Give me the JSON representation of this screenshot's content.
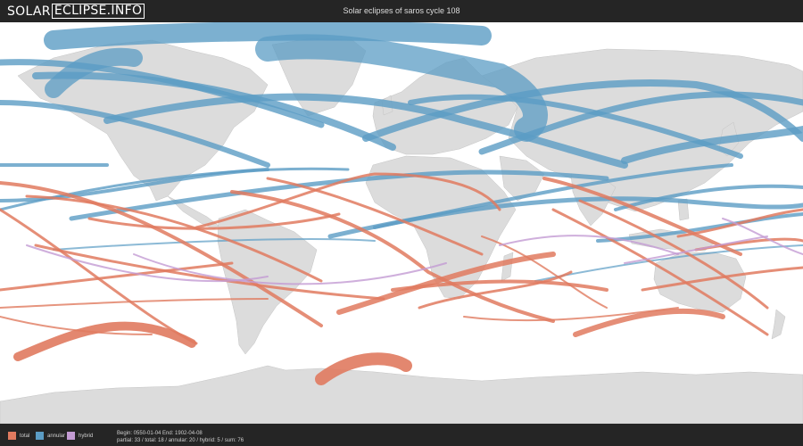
{
  "header": {
    "logo_word1": "SOLAR",
    "logo_word2": "ECLIPSE.INFO",
    "title": "Solar eclipses of saros cycle 108"
  },
  "legend": [
    {
      "label": "total",
      "color": "#e07a5f",
      "icon": "total-swatch"
    },
    {
      "label": "annular",
      "color": "#5b9cc4",
      "icon": "annular-swatch"
    },
    {
      "label": "hybrid",
      "color": "#c39bd3",
      "icon": "hybrid-swatch"
    }
  ],
  "stats": {
    "range": "Begin: 0550-01-04 End: 1902-04-08",
    "counts": "partial: 33 / total: 18 / annular: 20 / hybrid: 5 / sum: 76"
  },
  "colors": {
    "total": "#e07a5f",
    "annular": "#5b9cc4",
    "hybrid": "#c39bd3",
    "land": "#dcdcdc",
    "ocean": "#ffffff"
  }
}
